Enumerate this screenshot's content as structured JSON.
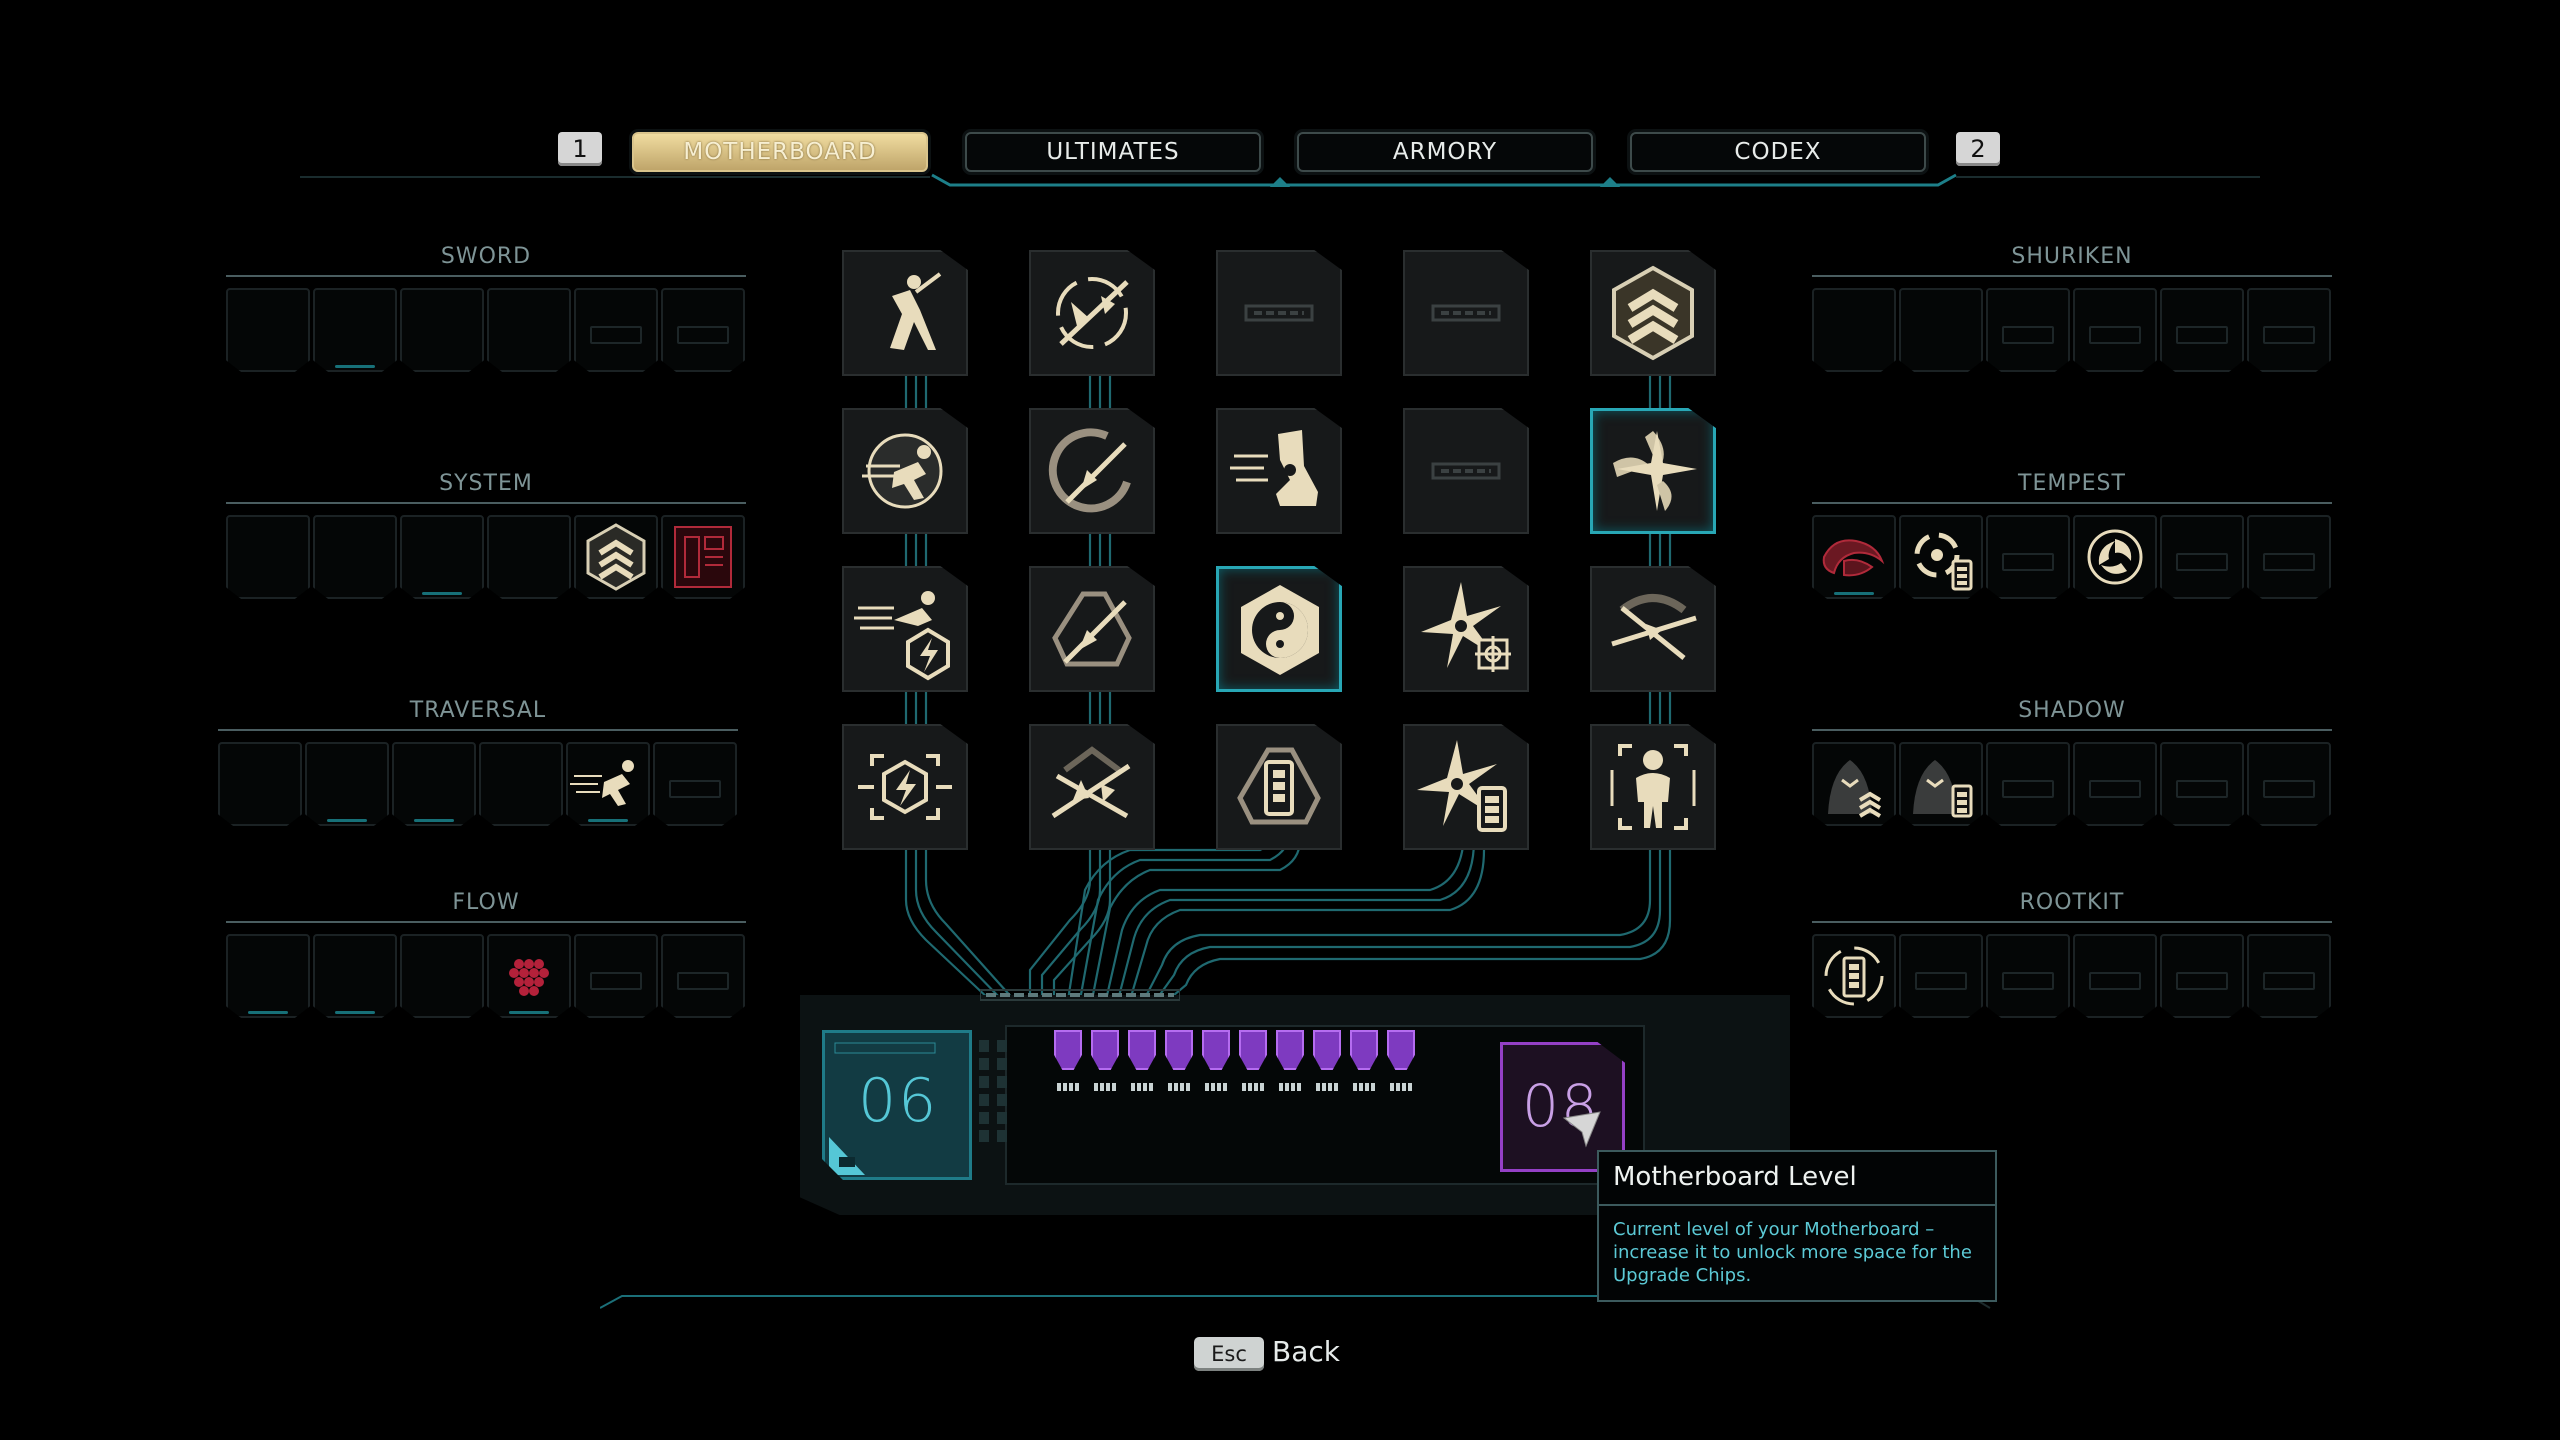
{
  "nav": {
    "key_left": "1",
    "key_right": "2",
    "tabs": [
      {
        "label": "MOTHERBOARD",
        "active": true
      },
      {
        "label": "ULTIMATES",
        "active": false
      },
      {
        "label": "ARMORY",
        "active": false
      },
      {
        "label": "CODEX",
        "active": false
      }
    ]
  },
  "left_categories": [
    {
      "label": "SWORD",
      "equipped": []
    },
    {
      "label": "SYSTEM",
      "equipped": [
        "chevron-rank-icon",
        "locked-red-chip-icon"
      ]
    },
    {
      "label": "TRAVERSAL",
      "equipped": [
        "dash-runner-icon"
      ]
    },
    {
      "label": "FLOW",
      "equipped": [
        "red-hex-cluster-icon"
      ]
    }
  ],
  "right_categories": [
    {
      "label": "SHURIKEN",
      "equipped": []
    },
    {
      "label": "TEMPEST",
      "equipped": [
        "red-swirl-icon",
        "tempest-battery-icon",
        "tempest-swirl-icon"
      ]
    },
    {
      "label": "SHADOW",
      "equipped": [
        "shadow-chevron-icon",
        "shadow-battery-icon"
      ]
    },
    {
      "label": "ROOTKIT",
      "equipped": [
        "rootkit-battery-icon"
      ]
    }
  ],
  "chips_grid": [
    [
      "ninja-leap-icon",
      "sword-slash-circle-icon",
      "empty-chip-icon",
      "empty-chip-icon",
      "triple-chevron-icon"
    ],
    [
      "dash-orb-icon",
      "crescent-blade-icon",
      "speed-boot-icon",
      "empty-chip-icon",
      "shuriken-wings-icon"
    ],
    [
      "dash-lightning-icon",
      "recycle-blade-icon",
      "yin-yang-hex-icon",
      "shuriken-target-icon",
      "crossed-blades-icon"
    ],
    [
      "lightning-target-icon",
      "shattered-blades-icon",
      "battery-recycle-icon",
      "shuriken-battery-icon",
      "shadow-figure-icon"
    ]
  ],
  "selected_chips": [
    "shuriken-wings-icon",
    "yin-yang-hex-icon"
  ],
  "motherboard": {
    "current_level": "06",
    "max_level": "08",
    "capacity_slots": 10
  },
  "tooltip": {
    "title": "Motherboard Level",
    "body": "Current level of your Motherboard – increase it to unlock more space for the Upgrade Chips."
  },
  "footer": {
    "esc_key": "Esc",
    "back_label": "Back"
  },
  "colors": {
    "accent_cyan": "#28a7b5",
    "active_tab_gold": "#d9c48c",
    "capacity_purple": "#9440c6",
    "locked_red": "#b02a3a",
    "icon_cream": "#e8dcbc"
  }
}
